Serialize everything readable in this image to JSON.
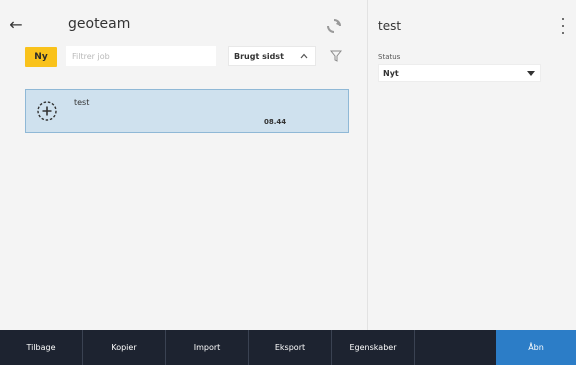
{
  "header": {
    "title": "geoteam"
  },
  "toolbar": {
    "new_label": "Ny",
    "filter_placeholder": "Filtrer job",
    "sort_label": "Brugt sidst"
  },
  "jobs": [
    {
      "name": "test",
      "time": "08.44"
    }
  ],
  "detail": {
    "title": "test",
    "status_label": "Status",
    "status_value": "Nyt"
  },
  "bottom_bar": {
    "back": "Tilbage",
    "copy": "Kopier",
    "import": "Import",
    "export": "Eksport",
    "properties": "Egenskaber",
    "open": "Åbn"
  },
  "colors": {
    "accent_yellow": "#f9c21b",
    "selected_bg": "#cfe1ee",
    "bottom_bar_bg": "#1d2330",
    "primary_blue": "#2c7dc7"
  },
  "icons": {
    "back": "arrow-left-icon",
    "sync": "sync-icon",
    "sort": "chevron-up-icon",
    "filter": "filter-icon",
    "job": "add-job-icon",
    "menu": "kebab-menu-icon",
    "status": "caret-down-icon"
  }
}
